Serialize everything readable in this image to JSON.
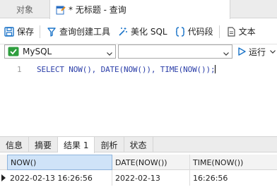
{
  "tabs": {
    "objects": "对象",
    "query": "* 无标题 - 查询"
  },
  "toolbar": {
    "save": "保存",
    "query_builder": "查询创建工具",
    "beautify_sql": "美化 SQL",
    "code_snippet": "代码段",
    "text": "文本"
  },
  "connection": {
    "selected": "MySQL",
    "database": "",
    "run": "运行"
  },
  "editor": {
    "line_number": "1",
    "code": "SELECT NOW(), DATE(NOW()), TIME(NOW());"
  },
  "result_tabs": [
    "信息",
    "摘要",
    "结果 1",
    "剖析",
    "状态"
  ],
  "active_result_tab": "结果 1",
  "grid": {
    "columns": [
      "NOW()",
      "DATE(NOW())",
      "TIME(NOW())"
    ],
    "rows": [
      [
        "2022-02-13 16:26:56",
        "2022-02-13",
        "16:26:56"
      ]
    ]
  },
  "colors": {
    "accent": "#1a73c8",
    "mysql_green": "#2e9e3e",
    "keyword_blue": "#2b3ea8"
  }
}
